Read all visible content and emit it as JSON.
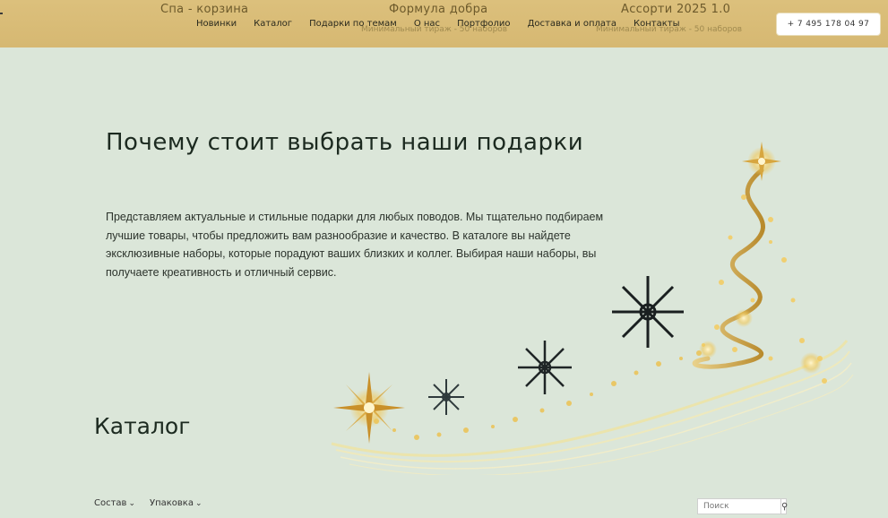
{
  "header": {
    "ghost_items": [
      {
        "title": "Спа - корзина",
        "sub": ""
      },
      {
        "title": "Формула добра",
        "sub": "Минимальный тираж - 50 наборов"
      },
      {
        "title": "Ассорти 2025 1.0",
        "sub": "Минимальный тираж - 50 наборов"
      }
    ],
    "nav": [
      "Новинки",
      "Каталог",
      "Подарки по темам",
      "О нас",
      "Портфолио",
      "Доставка и оплата",
      "Контакты"
    ],
    "phone": "+ 7 495 178 04 97"
  },
  "hero": {
    "title": "Почему стоит выбрать наши подарки",
    "text": "Представляем актуальные и стильные подарки для любых поводов. Мы тщательно подбираем лучшие товары, чтобы предложить вам разнообразие и качество. В каталоге вы найдете эксклюзивные наборы, которые порадуют ваших близких и коллег. Выбирая наши наборы, вы получаете креативность и отличный сервис."
  },
  "catalog": {
    "title": "Каталог",
    "filters": [
      "Состав",
      "Упаковка"
    ],
    "search_placeholder": "Поиск"
  },
  "colors": {
    "header_bg": "#d9bc77",
    "page_bg": "#dbe6d9",
    "gold": "#c9a24a"
  }
}
